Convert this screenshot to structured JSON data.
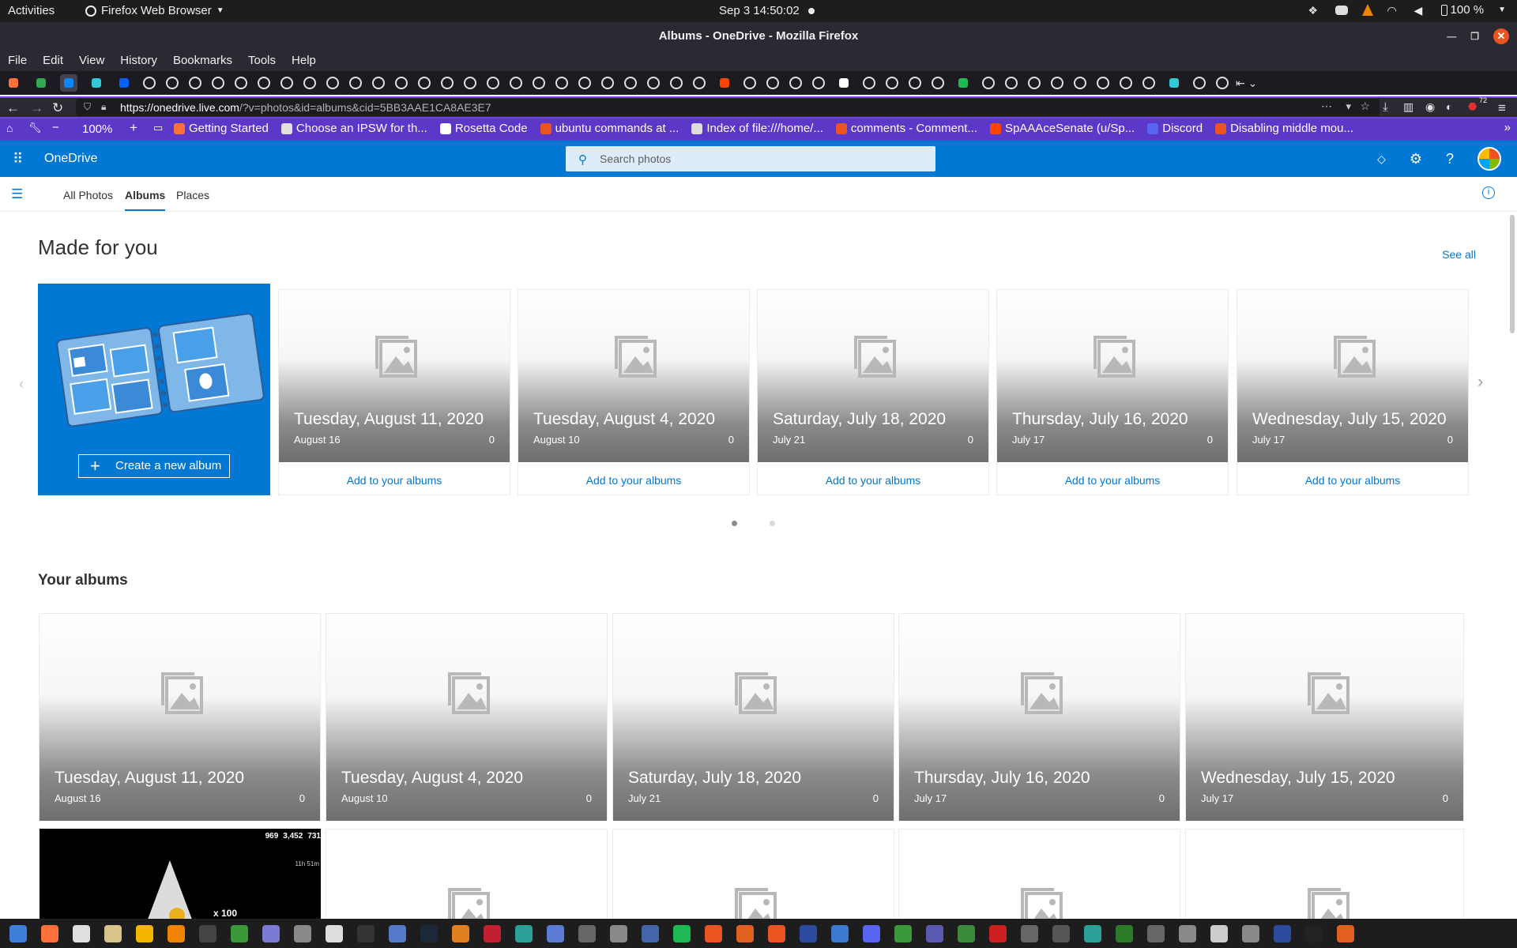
{
  "gnome_bar": {
    "activities": "Activities",
    "app_name": "Firefox Web Browser",
    "clock": "Sep 3  14:50:02",
    "battery": "100 %"
  },
  "window": {
    "title": "Albums - OneDrive - Mozilla Firefox"
  },
  "menubar": [
    "File",
    "Edit",
    "View",
    "History",
    "Bookmarks",
    "Tools",
    "Help"
  ],
  "navbar": {
    "url_host": "https://onedrive.live.com",
    "url_rest": "/?v=photos&id=albums&cid=5BB3AAE1CA8AE3E7",
    "badge": "72"
  },
  "bookmarks_bar": {
    "zoom": "100%",
    "items": [
      {
        "label": "Getting Started",
        "icon": "firefox-icon",
        "color": "#ff7139"
      },
      {
        "label": "Choose an IPSW for th...",
        "icon": "penguin-icon",
        "color": "#e0e0e0"
      },
      {
        "label": "Rosetta Code",
        "icon": "rosetta-icon",
        "color": "#ffffff"
      },
      {
        "label": "ubuntu commands at ...",
        "icon": "ubuntu-icon",
        "color": "#e95420"
      },
      {
        "label": "Index of file:///home/...",
        "icon": "page-icon",
        "color": "#dddddd"
      },
      {
        "label": "comments - Comment...",
        "icon": "chart-icon",
        "color": "#e95420"
      },
      {
        "label": "SpAAAceSenate (u/Sp...",
        "icon": "reddit-icon",
        "color": "#ff4500"
      },
      {
        "label": "Discord",
        "icon": "discord-icon",
        "color": "#5865f2"
      },
      {
        "label": "Disabling middle mou...",
        "icon": "askubuntu-icon",
        "color": "#e95420"
      }
    ]
  },
  "onedrive": {
    "brand": "OneDrive",
    "search_placeholder": "Search photos",
    "tabs": [
      "All Photos",
      "Albums",
      "Places"
    ],
    "active_tab": "Albums",
    "made_for_you": {
      "title": "Made for you",
      "see_all": "See all",
      "create_label": "Create a new album",
      "add_label": "Add to your albums",
      "cards": [
        {
          "date": "Tuesday, August 11, 2020",
          "sub": "August 16",
          "count": "0"
        },
        {
          "date": "Tuesday, August 4, 2020",
          "sub": "August 10",
          "count": "0"
        },
        {
          "date": "Saturday, July 18, 2020",
          "sub": "July 21",
          "count": "0"
        },
        {
          "date": "Thursday, July 16, 2020",
          "sub": "July 17",
          "count": "0"
        },
        {
          "date": "Wednesday, July 15, 2020",
          "sub": "July 17",
          "count": "0"
        }
      ],
      "page_index": 1,
      "page_count": 2
    },
    "your_albums": {
      "title": "Your albums",
      "cards": [
        {
          "date": "Tuesday, August 11, 2020",
          "sub": "August 16",
          "count": "0"
        },
        {
          "date": "Tuesday, August 4, 2020",
          "sub": "August 10",
          "count": "0"
        },
        {
          "date": "Saturday, July 18, 2020",
          "sub": "July 21",
          "count": "0"
        },
        {
          "date": "Thursday, July 16, 2020",
          "sub": "July 17",
          "count": "0"
        },
        {
          "date": "Wednesday, July 15, 2020",
          "sub": "July 17",
          "count": "0"
        }
      ],
      "game_card": {
        "stat1": "969",
        "stat2": "3,452",
        "stat3": "731",
        "multiplier": "x 100",
        "timer": "11h 51m"
      }
    }
  },
  "colors": {
    "accent": "#0078d4",
    "bookmarks_bg": "#5b38c8",
    "nav_border": "#7542e5"
  }
}
